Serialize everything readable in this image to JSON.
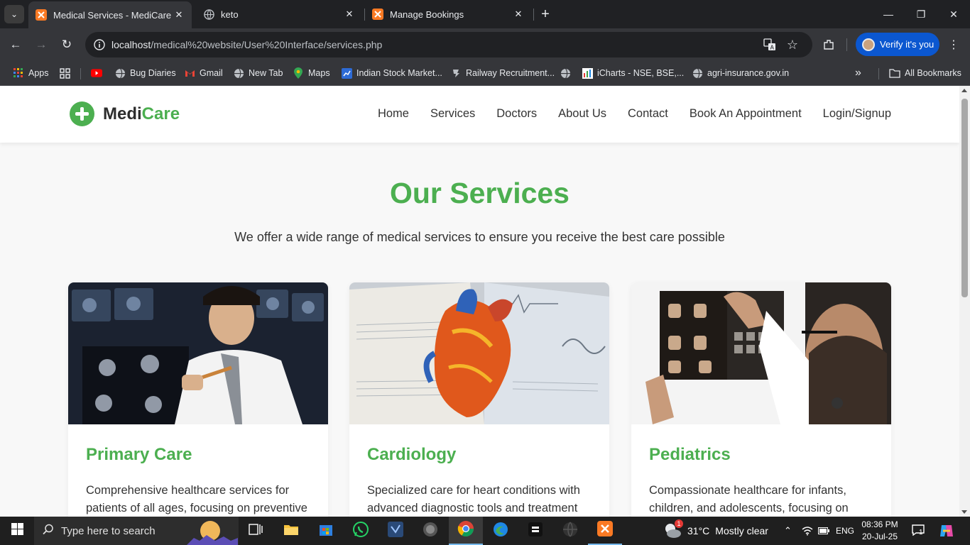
{
  "browser": {
    "tabs": [
      {
        "title": "Medical Services - MediCare",
        "active": true
      },
      {
        "title": "keto",
        "active": false
      },
      {
        "title": "Manage Bookings",
        "active": false
      }
    ],
    "url_host": "localhost",
    "url_path": "/medical%20website/User%20Interface/services.php",
    "verify_label": "Verify it's you",
    "bookmarks": [
      {
        "label": "Apps",
        "icon": "apps-grid-icon"
      },
      {
        "label": "",
        "icon": "grid-icon"
      },
      {
        "label": "",
        "icon": "youtube-icon"
      },
      {
        "label": "Bug Diaries",
        "icon": "globe-icon"
      },
      {
        "label": "Gmail",
        "icon": "gmail-icon"
      },
      {
        "label": "New Tab",
        "icon": "globe-icon"
      },
      {
        "label": "Maps",
        "icon": "maps-icon"
      },
      {
        "label": "Indian Stock Market...",
        "icon": "stock-icon"
      },
      {
        "label": "Railway Recruitment...",
        "icon": "rail-icon"
      },
      {
        "label": "",
        "icon": "globe-icon"
      },
      {
        "label": "iCharts - NSE, BSE,...",
        "icon": "icharts-icon"
      },
      {
        "label": "agri-insurance.gov.in",
        "icon": "globe-icon"
      }
    ],
    "more_bookmarks": "»",
    "all_bookmarks": "All Bookmarks"
  },
  "site": {
    "logo_part1": "Medi",
    "logo_part2": "Care",
    "nav": [
      "Home",
      "Services",
      "Doctors",
      "About Us",
      "Contact",
      "Book An Appointment",
      "Login/Signup"
    ],
    "title": "Our Services",
    "subtitle": "We offer a wide range of medical services to ensure you receive the best care possible",
    "services": [
      {
        "title": "Primary Care",
        "desc": "Comprehensive healthcare services for patients of all ages, focusing on preventive"
      },
      {
        "title": "Cardiology",
        "desc": "Specialized care for heart conditions with advanced diagnostic tools and treatment"
      },
      {
        "title": "Pediatrics",
        "desc": "Compassionate healthcare for infants, children, and adolescents, focusing on"
      }
    ],
    "accent": "#4caf50"
  },
  "taskbar": {
    "search_placeholder": "Type here to search",
    "weather_temp": "31°C",
    "weather_desc": "Mostly clear",
    "weather_badge": "1",
    "lang": "ENG",
    "time": "08:36 PM",
    "date": "20-Jul-25",
    "notif_count": "1"
  }
}
